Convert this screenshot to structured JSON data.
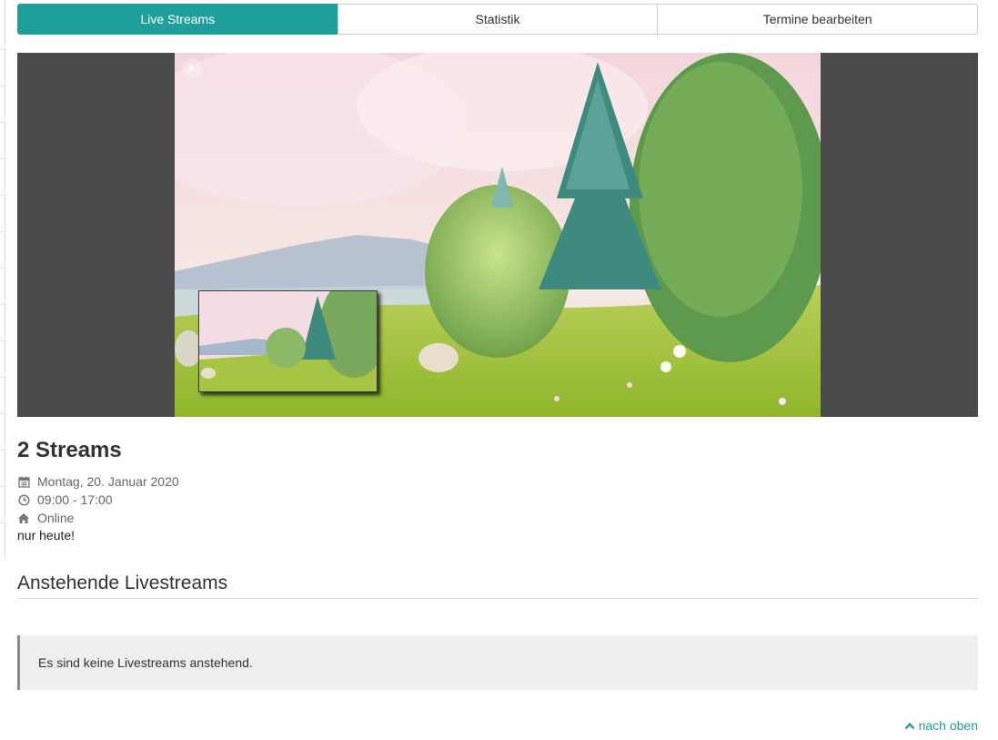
{
  "tabs": [
    {
      "label": "Live Streams",
      "active": true
    },
    {
      "label": "Statistik",
      "active": false
    },
    {
      "label": "Termine bearbeiten",
      "active": false
    }
  ],
  "event": {
    "title": "2 Streams",
    "date": "Montag, 20. Januar 2020",
    "time": "09:00 - 17:00",
    "location": "Online",
    "note": "nur heute!"
  },
  "upcoming": {
    "heading": "Anstehende Livestreams",
    "empty_message": "Es sind keine Livestreams anstehend."
  },
  "footer": {
    "back_to_top": "nach oben"
  },
  "icons": {
    "date": "calendar-icon",
    "time": "clock-icon",
    "location": "home-icon",
    "back_to_top": "chevron-up-icon"
  },
  "colors": {
    "accent": "#1f9f9c",
    "player_background": "#4a4a4a",
    "notice_background": "#eeeeee"
  }
}
